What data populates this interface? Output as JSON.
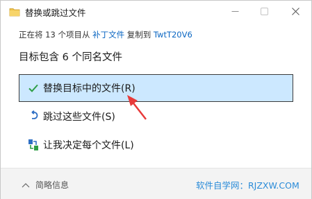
{
  "window": {
    "title": "替换或跳过文件",
    "controls": {
      "minimize": "minimize-icon",
      "maximize": "maximize-icon",
      "close": "close-icon"
    }
  },
  "status": {
    "prefix": "正在将 13 个项目从",
    "source": "补丁文件",
    "middle": "复制到",
    "destination": "TwtT20V6"
  },
  "heading": "目标包含 6 个同名文件",
  "options": [
    {
      "label": "替换目标中的文件(R)",
      "icon": "check-icon",
      "selected": true
    },
    {
      "label": "跳过这些文件(S)",
      "icon": "skip-icon",
      "selected": false
    },
    {
      "label": "让我决定每个文件(L)",
      "icon": "compare-icon",
      "selected": false
    }
  ],
  "footer": {
    "details_label": "简略信息",
    "watermark": "软件自学网：RJZXW.COM"
  },
  "colors": {
    "accent": "#0a66c2",
    "selection_bg": "#cce8ff",
    "check": "#2e9e46",
    "annotation_arrow": "#e83a3a",
    "watermark": "#2a8bd8"
  }
}
